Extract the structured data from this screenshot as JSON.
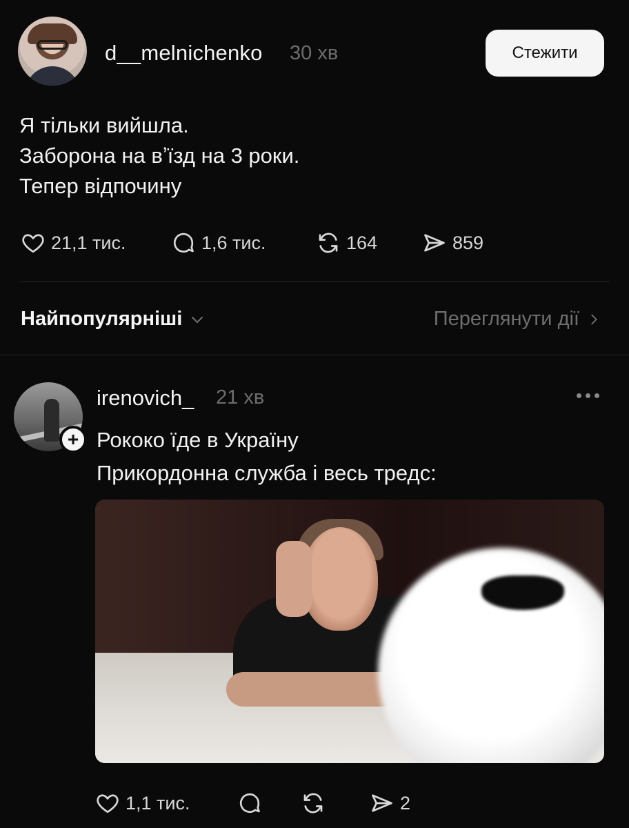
{
  "post": {
    "username": "d__melnichenko",
    "time": "30 хв",
    "follow_label": "Стежити",
    "lines": [
      "Я тільки вийшла.",
      "Заборона на вʼїзд на 3 роки.",
      "Тепер відпочину"
    ],
    "likes": "21,1 тис.",
    "comments": "1,6 тис.",
    "reposts": "164",
    "shares": "859"
  },
  "sort": {
    "label": "Найпопулярніші",
    "activity_link": "Переглянути дії"
  },
  "reply": {
    "username": "irenovich_",
    "time": "21 хв",
    "add_badge": "+",
    "lines": [
      "Рококо їде в Україну",
      "Прикордонна служба і весь тредс:"
    ],
    "likes": "1,1 тис.",
    "shares": "2"
  },
  "colors": {
    "background": "#0a0a0a",
    "text": "#f3f3f3",
    "muted": "#6d6d6d",
    "button_bg": "#f5f5f5"
  },
  "icons": [
    "heart-icon",
    "comment-icon",
    "repost-icon",
    "share-icon",
    "chevron-down-icon",
    "chevron-right-icon",
    "more-icon",
    "plus-icon"
  ]
}
